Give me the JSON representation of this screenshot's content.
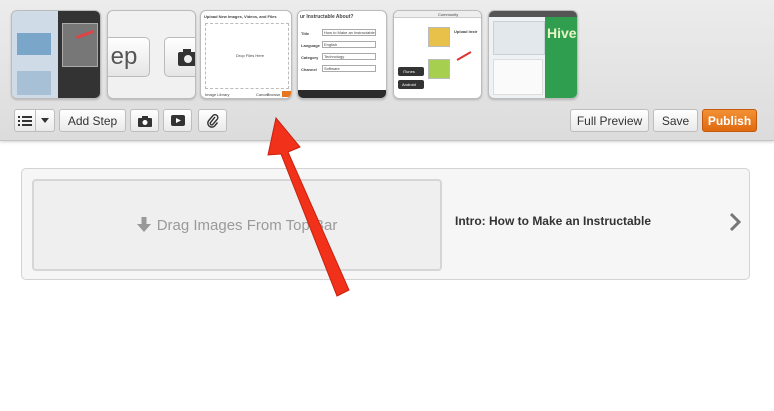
{
  "toolbar": {
    "add_step_label": "Add Step",
    "full_preview_label": "Full Preview",
    "save_label": "Save",
    "publish_label": "Publish",
    "list_icon": "list-icon",
    "dropdown_icon": "caret-down-icon",
    "camera_icon": "camera-icon",
    "video_icon": "video-icon",
    "attach_icon": "paperclip-icon",
    "publish_color": "#e8761f"
  },
  "thumbnails": {
    "thumb2_text": "ep",
    "thumb3_title": "Upload New Images, Videos, and Files",
    "thumb3_drop": "Drop Files Here",
    "thumb3_cancel": "Cancel",
    "thumb3_browse": "Browse",
    "thumb3_upload": "Image Library",
    "thumb4_title": "ur Instructable About?",
    "thumb4_rows": [
      {
        "label": "Title",
        "value": "How to Make an Instructable"
      },
      {
        "label": "Language",
        "value": "English"
      },
      {
        "label": "Category",
        "value": "Technology"
      },
      {
        "label": "Channel",
        "value": "Software"
      }
    ],
    "thumb5_nav": "Community",
    "thumb5_upload": "Upload Instr",
    "thumb5_itunes": "iTunes",
    "thumb5_android": "Android",
    "thumb6_brand": "Hive"
  },
  "step": {
    "drop_label": "Drag Images From Top Bar",
    "title": "Intro: How to Make an Instructable",
    "download_icon": "download-arrow-icon",
    "chevron_icon": "chevron-right-icon"
  },
  "annotation": {
    "arrow_color": "#f2311b"
  }
}
